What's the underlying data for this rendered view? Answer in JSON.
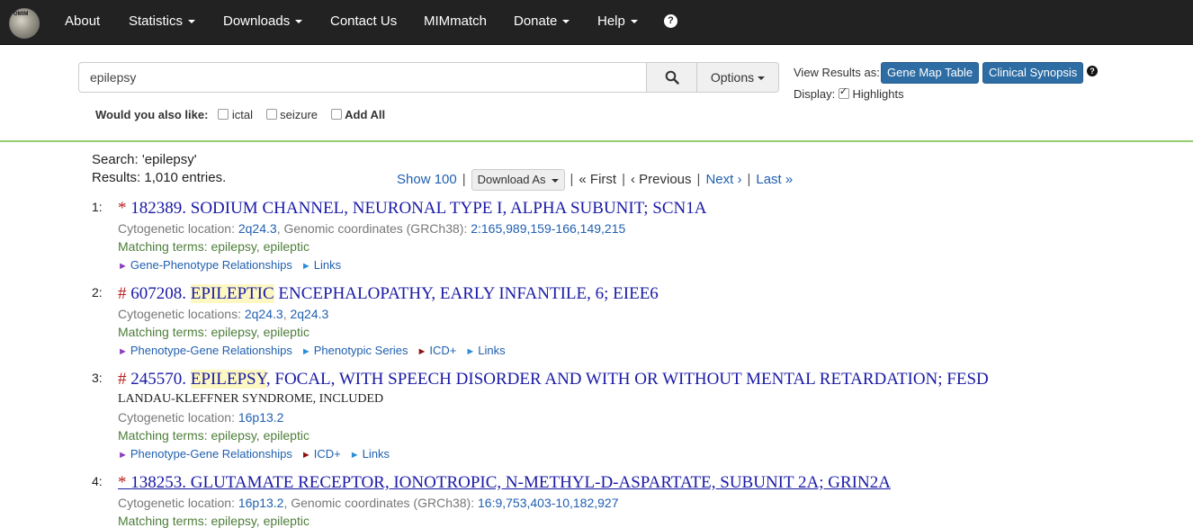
{
  "nav": {
    "logo_text": "OMIM",
    "about": "About",
    "statistics": "Statistics",
    "downloads": "Downloads",
    "contact": "Contact Us",
    "mimmatch": "MIMmatch",
    "donate": "Donate",
    "help": "Help",
    "help_icon": "?"
  },
  "search": {
    "value": "epilepsy",
    "options_label": "Options",
    "view_results_label": "View Results as:",
    "gene_map_table": "Gene Map Table",
    "clinical_synopsis": "Clinical Synopsis",
    "display_label": "Display:",
    "highlights_label": "Highlights",
    "also_like_label": "Would you also like:",
    "suggestions": [
      "ictal",
      "seizure"
    ],
    "add_all": "Add All"
  },
  "results": {
    "search_text": "Search: 'epilepsy'",
    "count_text": "Results: 1,010 entries.",
    "show_100": "Show 100",
    "download_as": "Download As",
    "first": "« First",
    "previous": "‹ Previous",
    "next": "Next ›",
    "last": "Last »"
  },
  "entries": [
    {
      "num": "1:",
      "prefix": "*",
      "title_pre": "182389. SODIUM CHANNEL, NEURONAL TYPE I, ALPHA SUBUNIT; SCN1A",
      "cyto_label": "Cytogenetic location:",
      "cyto": "2q24.3",
      "genomic_label": ", Genomic coordinates (GRCh38):",
      "genomic": "2:165,989,159-166,149,215",
      "matching_label": "Matching terms:",
      "matching": "epilepsy, epileptic",
      "link1": "Gene-Phenotype Relationships",
      "link2": "Links"
    },
    {
      "num": "2:",
      "prefix": "#",
      "title_pre": "607208.",
      "title_hl": "EPILEPTIC",
      "title_post": "ENCEPHALOPATHY, EARLY INFANTILE, 6; EIEE6",
      "cyto_label": "Cytogenetic locations:",
      "cyto": "2q24.3",
      "cyto2": "2q24.3",
      "matching_label": "Matching terms:",
      "matching": "epilepsy, epileptic",
      "link1": "Phenotype-Gene Relationships",
      "link2": "Phenotypic Series",
      "link3": "ICD+",
      "link4": "Links"
    },
    {
      "num": "3:",
      "prefix": "#",
      "title_pre": "245570.",
      "title_hl": "EPILEPSY",
      "title_post": ", FOCAL, WITH SPEECH DISORDER AND WITH OR WITHOUT MENTAL RETARDATION; FESD",
      "subtitle": "LANDAU-KLEFFNER SYNDROME, INCLUDED",
      "cyto_label": "Cytogenetic location:",
      "cyto": "16p13.2",
      "matching_label": "Matching terms:",
      "matching": "epilepsy, epileptic",
      "link1": "Phenotype-Gene Relationships",
      "link2": "ICD+",
      "link3": "Links"
    },
    {
      "num": "4:",
      "prefix": "*",
      "title_pre": "138253. GLUTAMATE RECEPTOR, IONOTROPIC, N-METHYL-D-ASPARTATE, SUBUNIT 2A; GRIN2A",
      "cyto_label": "Cytogenetic location:",
      "cyto": "16p13.2",
      "genomic_label": ", Genomic coordinates (GRCh38):",
      "genomic": "16:9,753,403-10,182,927",
      "matching_label": "Matching terms:",
      "matching": "epilepsy, epileptic"
    }
  ]
}
